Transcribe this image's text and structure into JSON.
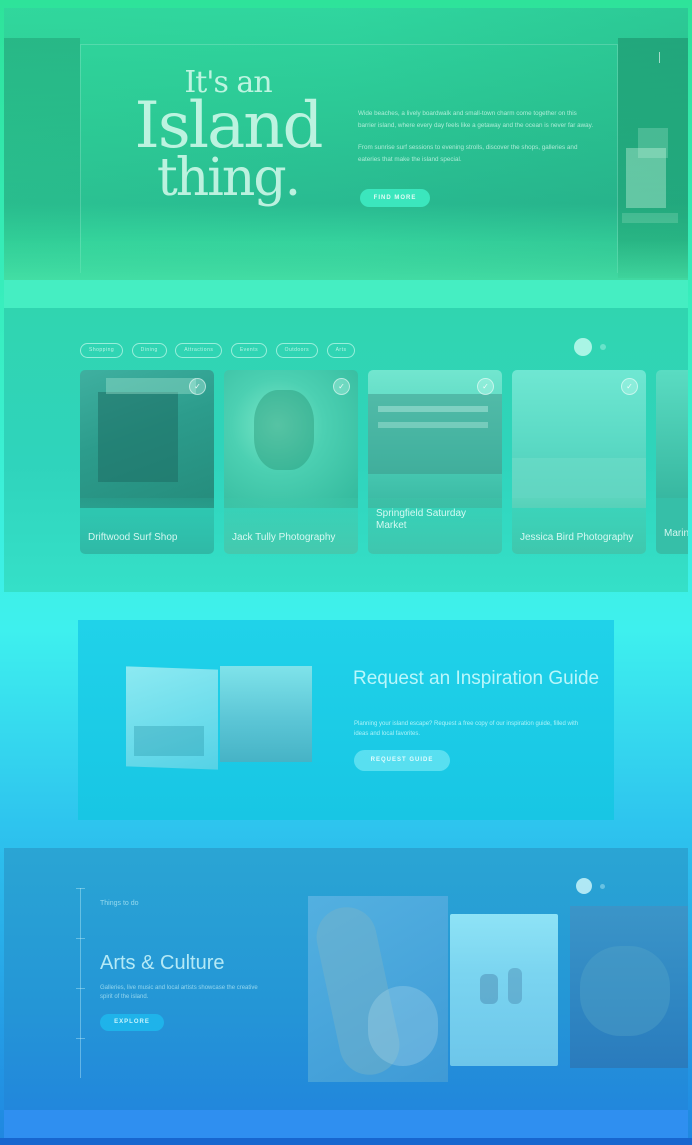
{
  "hero": {
    "title_line1": "It's an",
    "title_line2": "Island",
    "title_line3": "thing.",
    "paragraph1": "Wide beaches, a lively boardwalk and small-town charm come together on this barrier island, where every day feels like a getaway and the ocean is never far away.",
    "paragraph2": "From sunrise surf sessions to evening strolls, discover the shops, galleries and eateries that make the island special.",
    "button_label": "Find more"
  },
  "explore": {
    "chips": [
      "Shopping",
      "Dining",
      "Attractions",
      "Events",
      "Outdoors",
      "Arts"
    ],
    "cards": [
      {
        "label": "Driftwood Surf Shop"
      },
      {
        "label": "Jack Tully Photography"
      },
      {
        "label": "Springfield Saturday Market"
      },
      {
        "label": "Jessica Bird Photography"
      },
      {
        "label": "Marine Night Stand"
      }
    ]
  },
  "guide": {
    "title": "Request an Inspiration Guide",
    "description": "Planning your island escape? Request a free copy of our inspiration guide, filled with ideas and local favorites.",
    "button_label": "Request guide"
  },
  "arts": {
    "kicker": "Things to do",
    "title": "Arts & Culture",
    "description": "Galleries, live music and local artists showcase the creative spirit of the island.",
    "button_label": "Explore"
  },
  "colors": {
    "hero_accent": "#3be6bd",
    "guide_bg": "#1ccbe6",
    "arts_bg": "#2496d6"
  }
}
